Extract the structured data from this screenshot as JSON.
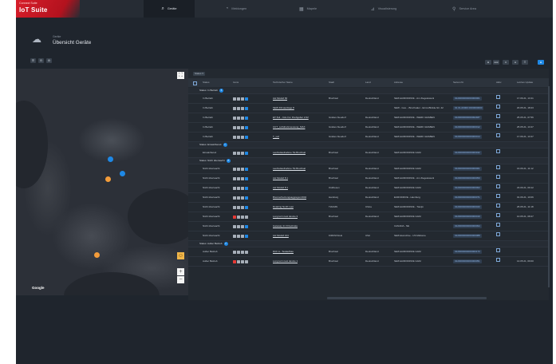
{
  "app": {
    "brand_small": "Connect Suite",
    "product": "IoT Suite"
  },
  "nav": {
    "tabs": [
      "Geräte",
      "Meldungen",
      "Mapele",
      "Visualisierung",
      "Service Area"
    ]
  },
  "page": {
    "breadcrumb": "Geräte",
    "title": "Übersicht Geräte"
  },
  "toolbar": {
    "left_buttons": [
      "☰",
      "⊟",
      "⚙"
    ],
    "right_buttons": [
      "⊞",
      "⊞⊞",
      "⊡",
      "⊟",
      "☰",
      "⊞"
    ]
  },
  "map": {
    "google_label": "Google",
    "zoom_in": "+",
    "zoom_out": "−",
    "fullscreen": "⛶",
    "pegman": "☺",
    "marker_colors": {
      "blue": "#1e88e5",
      "orange": "#f39c3a"
    }
  },
  "table": {
    "group_tag": "Status ▾",
    "headers": [
      "Status",
      "Icons",
      "Technischer Name",
      "Stadt",
      "Land",
      "Adresse",
      "Serien-Nr.",
      "Aktiv",
      "Letztes Update"
    ],
    "groups": [
      {
        "label": "Status: In Betrieb",
        "count": "5",
        "rows": [
          {
            "status": "In Betrieb",
            "name": "Ast Modell 84",
            "city": "Bruchsal",
            "country": "Deutschland",
            "address": "SEW-EURODRIVE - Am Ziegeleiwerk",
            "serial": "0120000000000000001",
            "date": "17.06.21, 13:41"
          },
          {
            "status": "In Betrieb",
            "name": "SEW-Klimaanlage 8",
            "city": "",
            "country": "",
            "address": "SEW - Ges. - Bruchsaler - Ernst-Blickle-Str. 42",
            "serial": "01.01-00000 0000000000",
            "date": "20.05.21, 18:23"
          },
          {
            "status": "In Betrieb",
            "name": "ET-Teil - CAL Fw. Drehgeber 2.62",
            "city": "Graben-Neudorf",
            "country": "Deutschland",
            "address": "SEW-EURODRIVE - WERK GRABEN",
            "serial": "0120000000000002487",
            "date": "25.05.21, 07:56"
          },
          {
            "status": "In Betrieb",
            "name": "CCT_Luftdruckmessung_MAX",
            "city": "Graben-Neudorf",
            "country": "Deutschland",
            "address": "SEW-EURODRIVE - WERK GRABEN",
            "serial": "0120000000000000012",
            "date": "25.05.21, 13:47"
          },
          {
            "status": "In Betrieb",
            "name": "T_vorl",
            "city": "Graben-Neudorf",
            "country": "Deutschland",
            "address": "SEW-EURODRIVE - WERK GRABEN",
            "serial": "0120000000000000014",
            "date": "17.06.21, 13:47"
          }
        ]
      },
      {
        "label": "Status: Einsatzbereit",
        "count": "1",
        "rows": [
          {
            "status": "Einsatzbereit",
            "name": "Laufzeitaufnahme TE Bruchsal",
            "city": "Bruchsal",
            "country": "Deutschland",
            "address": "SEW-EURODRIVE GGM",
            "serial": "0120000000000000342",
            "date": ""
          }
        ]
      },
      {
        "label": "Status: Nicht überwacht",
        "count": "8",
        "rows": [
          {
            "status": "Nicht überwacht",
            "name": "Laufzeitaufnahme TE Bruchsal",
            "city": "Bruchsal",
            "country": "Deutschland",
            "address": "SEW-EURODRIVE GGM",
            "serial": "0120000000000000001",
            "date": "16.06.21, 11:12"
          },
          {
            "status": "Nicht überwacht",
            "name": "Ast Modell 8.1",
            "city": "Bruchsal",
            "country": "Deutschland",
            "address": "SEW-EURODRIVE - Am Ziegeleiwerk",
            "serial": "0120000000000000050",
            "date": ""
          },
          {
            "status": "Nicht überwacht",
            "name": "Ast Modell 8.1",
            "city": "Ostfriesen",
            "country": "Deutschland",
            "address": "SEW-EURODRIVE GGM",
            "serial": "0120000000000000002",
            "date": "23.06.21, 09:12"
          },
          {
            "status": "Nicht überwacht",
            "name": "Brennerheizungsaggregat 2004",
            "city": "Hamburg",
            "country": "Deutschland",
            "address": "EURODRIVE - Hamburg",
            "serial": "0120000000000000071",
            "date": "01.06.21, 10:06"
          },
          {
            "status": "Nicht überwacht",
            "name": "Rotating North Last",
            "city": "TIANJIN",
            "country": "China",
            "address": "SEW-EURODRIVE - Tianjin",
            "serial": "0120000000000000043",
            "date": "25.05.21, 11:18"
          },
          {
            "status": "Nicht überwacht",
            "name": "Long term test device 3",
            "city": "Bruchsal",
            "country": "Deutschland",
            "address": "SEW-EURODRIVE GGM",
            "serial": "0120000000000000019",
            "date": "10.05.21, 08:27"
          },
          {
            "status": "Nicht überwacht",
            "name": "Gateway 2x Drivebrake",
            "city": "",
            "country": "",
            "address": "CANADA - NE",
            "serial": "0120000000000000094",
            "date": ""
          },
          {
            "status": "Nicht überwacht",
            "name": "Ast Modell 104",
            "city": "KIRKSVILLE",
            "country": "USA",
            "address": "SEW-Eurodrive - US Midstore",
            "serial": "0120000000000000088",
            "date": ""
          }
        ]
      },
      {
        "label": "Status: Außer Betrieb",
        "count": "2",
        "rows": [
          {
            "status": "Außer Betrieb",
            "name": "DCF A - Testaufbau",
            "city": "Bruchsal",
            "country": "Deutschland",
            "address": "SEW-EURODRIVE GGM",
            "serial": "0120000000000000173",
            "date": ""
          },
          {
            "status": "Außer Betrieb",
            "name": "Long term test device 1",
            "city": "Bruchsal",
            "country": "Deutschland",
            "address": "SEW-EURODRIVE GGM",
            "serial": "0120000000000000051",
            "date": "14.05.21, 09:00"
          }
        ]
      }
    ]
  }
}
